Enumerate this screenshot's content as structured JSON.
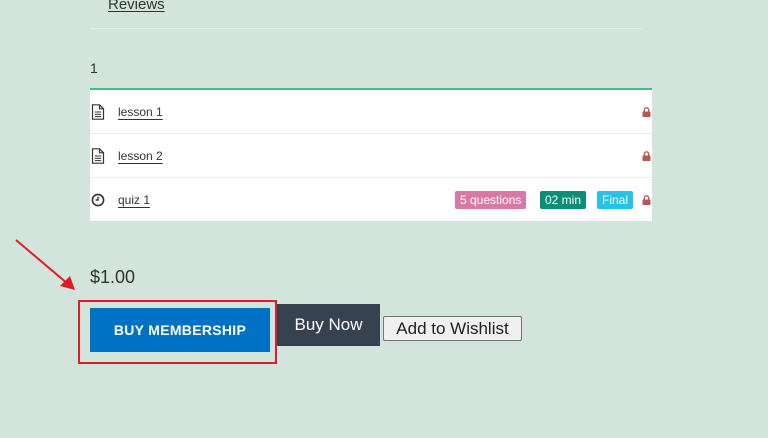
{
  "tabs": {
    "reviews": "Reviews"
  },
  "section": {
    "title": "1"
  },
  "curriculum": {
    "items": [
      {
        "type": "lesson",
        "icon": "document-icon",
        "title": "lesson 1",
        "locked": true
      },
      {
        "type": "lesson",
        "icon": "document-icon",
        "title": "lesson 2",
        "locked": true
      },
      {
        "type": "quiz",
        "icon": "clock-icon",
        "title": "quiz 1",
        "locked": true,
        "badges": {
          "questions": "5 questions",
          "duration": "02 min",
          "final": "Final"
        }
      }
    ]
  },
  "purchase": {
    "price": "$1.00",
    "buy_membership_label": "BUY MEMBERSHIP",
    "buy_now_label": "Buy Now",
    "wishlist_label": "Add to Wishlist"
  },
  "colors": {
    "background": "#d2e4dc",
    "primary_button": "#0072c6",
    "dark_button": "#374250",
    "highlight": "#e11d24",
    "badge_questions": "#d978a6",
    "badge_duration": "#098e78",
    "badge_final": "#25c2e9",
    "lock": "#b5584f"
  }
}
